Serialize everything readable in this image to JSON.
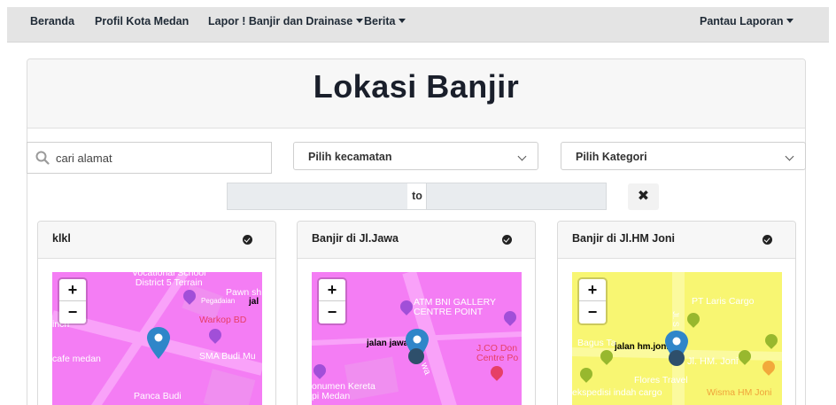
{
  "nav": {
    "beranda": "Beranda",
    "profil": "Profil Kota Medan",
    "lapor": "Lapor ! Banjir dan Drainase",
    "berita": "Berita",
    "pantau": "Pantau Laporan"
  },
  "page": {
    "title": "Lokasi Banjir"
  },
  "filters": {
    "search_placeholder": "cari alamat",
    "kecamatan": "Pilih kecamatan",
    "kategori": "Pilih Kategori",
    "date_separator": "to",
    "clear": "✖"
  },
  "colors": {
    "map_pink": "#f47df4",
    "map_yellow": "#f8f672",
    "marker": "#2f86c9"
  },
  "cards": [
    {
      "title": "klkl",
      "map_color": "pink",
      "map_labels": {
        "school": "Vocational School\nDistrict 5 Terrain",
        "pawn": "Pawn sh",
        "pegadaian": "Pegadaian",
        "jalan": "jal",
        "warkop": "Warkop BD",
        "sma": "SMA Budi Mu",
        "cafe": "cafe medan",
        "inch": "inch",
        "panca": "Panca Budi"
      }
    },
    {
      "title": "Banjir di Jl.Jawa",
      "map_color": "pink",
      "map_labels": {
        "atm": "ATM BNI GALLERY\nCENTRE POINT",
        "marker_label": "jalan jawa",
        "jco": "J.CO Don\nCentre Po",
        "monumen": "onumen Kereta\npi Medan",
        "street": "wa"
      }
    },
    {
      "title": "Banjir di Jl.HM Joni",
      "map_color": "yellow",
      "map_labels": {
        "pt": "PT Laris Cargo",
        "street_v": "Jl. S",
        "bagus": "Bagus Ta",
        "marker_label": "jalan hm.joni",
        "street_hm": "Jl. HM. Joni",
        "flores": "Flores Travel",
        "ekspedisi": "ekspedisi indah cargo",
        "wisma": "Wisma HM Joni"
      }
    }
  ],
  "map_controls": {
    "zoom_in": "+",
    "zoom_out": "−"
  }
}
